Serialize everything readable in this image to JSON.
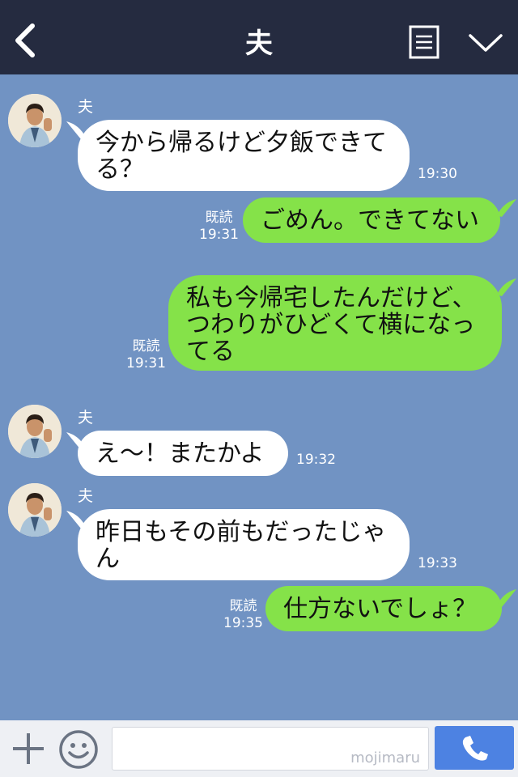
{
  "header": {
    "back_icon": "chevron-left-icon",
    "title": "夫",
    "notes_icon": "note-icon",
    "expand_icon": "chevron-down-icon"
  },
  "messages": [
    {
      "side": "in",
      "sender": "夫",
      "lines": [
        "今から帰るけど夕飯できて",
        "る？"
      ],
      "time": "19:30"
    },
    {
      "side": "out",
      "read": "既読",
      "lines": [
        "ごめん。できてない"
      ],
      "time": "19:31"
    },
    {
      "side": "out",
      "read": "既読",
      "lines": [
        "私も今帰宅したんだけど、",
        "つわりがひどくて横になっ",
        "てる"
      ],
      "time": "19:31"
    },
    {
      "side": "in",
      "sender": "夫",
      "lines": [
        "え〜！またかよ"
      ],
      "time": "19:32"
    },
    {
      "side": "in",
      "sender": "夫",
      "lines": [
        "昨日もその前もだったじゃ",
        "ん"
      ],
      "time": "19:33"
    },
    {
      "side": "out",
      "read": "既読",
      "lines": [
        "仕方ないでしょ？"
      ],
      "time": "19:35"
    }
  ],
  "footer": {
    "plus_icon": "plus-icon",
    "emoji_icon": "smiley-icon",
    "input_value": "",
    "watermark": "mojimaru",
    "call_icon": "phone-icon"
  },
  "colors": {
    "header_bg": "#252b40",
    "chat_bg": "#7193c3",
    "incoming_bubble": "#ffffff",
    "outgoing_bubble": "#85e249",
    "call_button": "#4d82e2"
  }
}
